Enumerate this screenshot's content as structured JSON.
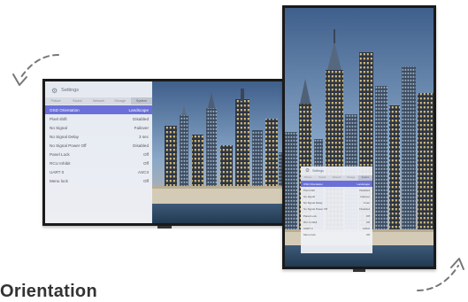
{
  "osd": {
    "title": "Settings",
    "tabs": [
      "Picture",
      "Sound",
      "Network",
      "Storage",
      "System"
    ],
    "active_tab_index": 4,
    "selected_row_index": 0,
    "rows": [
      {
        "label": "OSD Orientation",
        "value": "Landscape"
      },
      {
        "label": "Pixel shift",
        "value": "Disabled"
      },
      {
        "label": "No Signal",
        "value": "Failover"
      },
      {
        "label": "No Signal Delay",
        "value": "3 sec"
      },
      {
        "label": "No Signal Power Off",
        "value": "Disabled"
      },
      {
        "label": "Panel Lock",
        "value": "Off"
      },
      {
        "label": "RCU Inhibit",
        "value": "Off"
      },
      {
        "label": "UART 0",
        "value": "ASCII"
      },
      {
        "label": "Menu lock",
        "value": "Off"
      }
    ]
  },
  "caption": "Orientation",
  "colors": {
    "selected_row": "#6a70d8",
    "bezel": "#1a1a1a"
  },
  "icons": {
    "settings": "gear-icon",
    "rotate_left": "curved-arrow-icon",
    "rotate_right": "curved-arrow-icon"
  }
}
